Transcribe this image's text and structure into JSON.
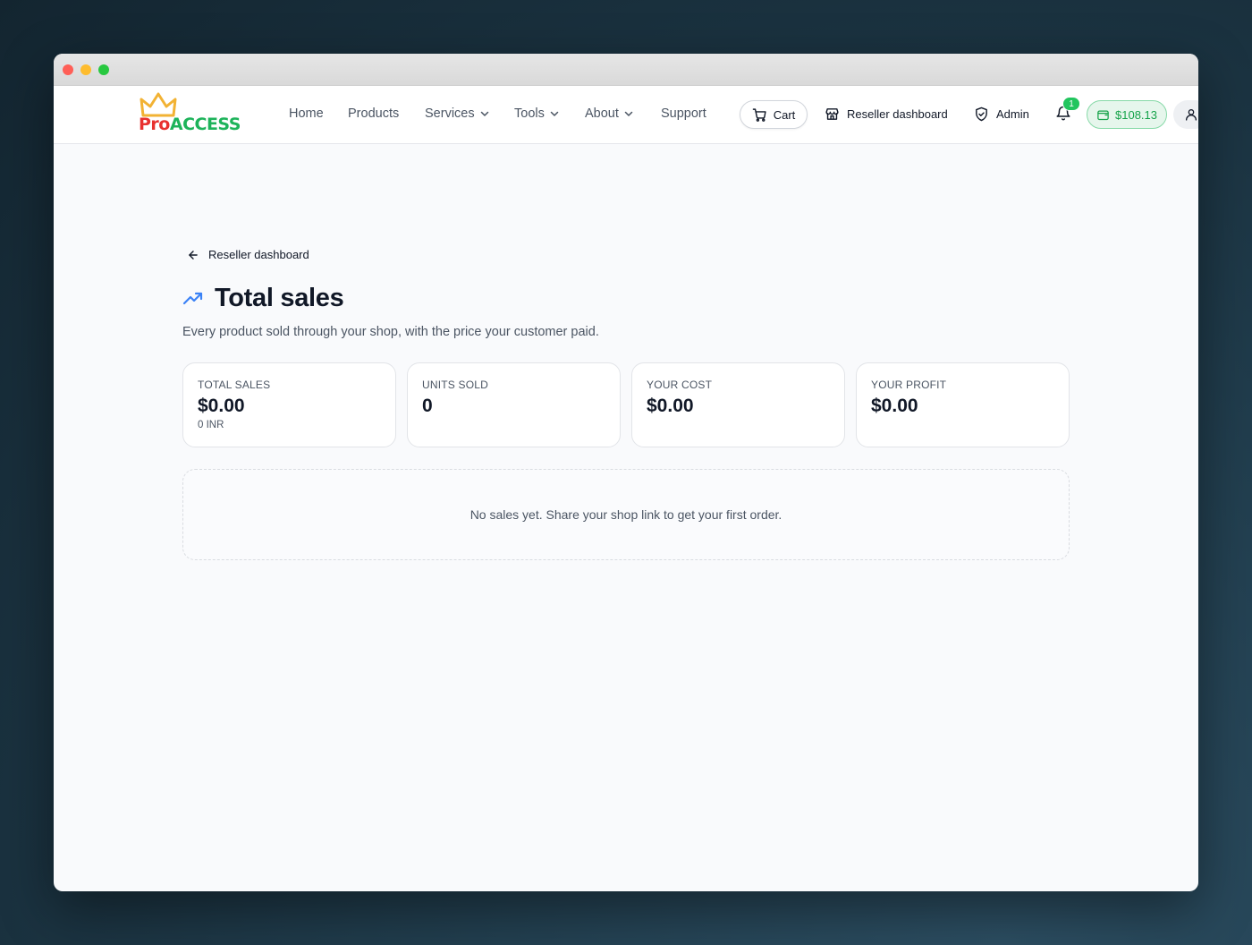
{
  "brand": {
    "logo_pro": "Pro",
    "logo_access": "ACCESS",
    "colors": {
      "pro": "#e8312f",
      "access": "#1db35a",
      "crown": "#f2b233"
    }
  },
  "nav": {
    "links": [
      {
        "label": "Home"
      },
      {
        "label": "Products"
      },
      {
        "label": "Services",
        "dropdown": true
      },
      {
        "label": "Tools",
        "dropdown": true
      },
      {
        "label": "About",
        "dropdown": true
      },
      {
        "label": "Support"
      }
    ],
    "cart_label": "Cart",
    "reseller_label": "Reseller dashboard",
    "admin_label": "Admin",
    "notification_count": "1",
    "wallet_balance": "$108.13"
  },
  "page": {
    "back_label": "Reseller dashboard",
    "title": "Total sales",
    "subtitle": "Every product sold through your shop, with the price your customer paid.",
    "stats": [
      {
        "label": "TOTAL SALES",
        "value": "$0.00",
        "sub": "0 INR"
      },
      {
        "label": "UNITS SOLD",
        "value": "0",
        "sub": ""
      },
      {
        "label": "YOUR COST",
        "value": "$0.00",
        "sub": ""
      },
      {
        "label": "YOUR PROFIT",
        "value": "$0.00",
        "sub": ""
      }
    ],
    "empty_message": "No sales yet. Share your shop link to get your first order."
  }
}
